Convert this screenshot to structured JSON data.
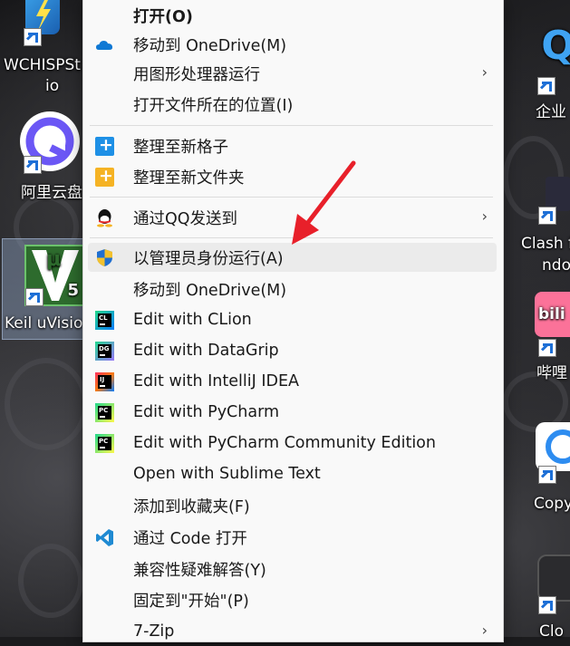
{
  "desktop": {
    "icons": [
      {
        "label_line1": "WCHISPSt",
        "label_line2": "io"
      },
      {
        "label_line1": "阿里云盘",
        "label_line2": ""
      },
      {
        "label_line1": "Keil uVisio",
        "label_line2": ""
      },
      {
        "label_line1": "企业",
        "label_line2": ""
      },
      {
        "label_line1": "Clash f",
        "label_line2": "ndo"
      },
      {
        "label_line1": "哔哩",
        "label_line2": ""
      },
      {
        "label_line1": "Copy",
        "label_line2": ""
      },
      {
        "label_line1": "Clo",
        "label_line2": ""
      }
    ],
    "keil_badge": "μ",
    "keil_version": "5",
    "bili_text": "bili",
    "qq_partial": "Q"
  },
  "menu": {
    "items": [
      {
        "label": "打开(O)",
        "icon": ""
      },
      {
        "label": "移动到 OneDrive(M)",
        "icon": "onedrive-icon"
      },
      {
        "label": "用图形处理器运行",
        "icon": "",
        "submenu": "›"
      },
      {
        "label": "打开文件所在的位置(I)",
        "icon": ""
      },
      {
        "label": "整理至新格子",
        "icon": "plus-grid-icon",
        "glyph": "+"
      },
      {
        "label": "整理至新文件夹",
        "icon": "plus-folder-icon",
        "glyph": "+"
      },
      {
        "label": "通过QQ发送到",
        "icon": "qq-icon",
        "submenu": "›"
      },
      {
        "label": "以管理员身份运行(A)",
        "icon": "uac-shield-icon"
      },
      {
        "label": "移动到 OneDrive(M)",
        "icon": ""
      },
      {
        "label": "Edit with CLion",
        "icon": "clion-icon",
        "badge": "CL"
      },
      {
        "label": "Edit with DataGrip",
        "icon": "datagrip-icon",
        "badge": "DG"
      },
      {
        "label": "Edit with IntelliJ IDEA",
        "icon": "intellij-icon",
        "badge": "IJ"
      },
      {
        "label": "Edit with PyCharm",
        "icon": "pycharm-icon",
        "badge": "PC"
      },
      {
        "label": "Edit with PyCharm Community Edition",
        "icon": "pycharm-ce-icon",
        "badge": "PC"
      },
      {
        "label": "Open with Sublime Text",
        "icon": ""
      },
      {
        "label": "添加到收藏夹(F)",
        "icon": ""
      },
      {
        "label": "通过 Code 打开",
        "icon": "vscode-icon"
      },
      {
        "label": "兼容性疑难解答(Y)",
        "icon": ""
      },
      {
        "label": "固定到\"开始\"(P)",
        "icon": ""
      },
      {
        "label": "7-Zip",
        "icon": "",
        "submenu": "›"
      }
    ]
  },
  "colors": {
    "menu_bg": "#f9f9f9",
    "hover_bg": "#ebebeb",
    "annotation_arrow": "#e8202a",
    "onedrive": "#0f78d4",
    "vscode": "#1f8ad2"
  }
}
